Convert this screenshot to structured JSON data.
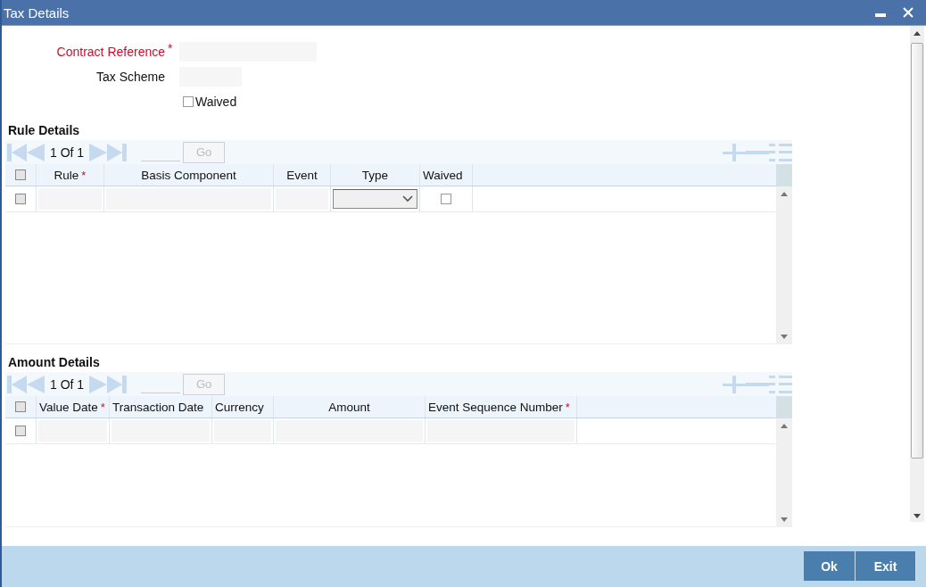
{
  "window": {
    "title": "Tax Details"
  },
  "form": {
    "contract_reference": {
      "label": "Contract Reference",
      "required_mark": "*"
    },
    "tax_scheme": {
      "label": "Tax Scheme"
    },
    "waived": {
      "label": "Waived",
      "checked": false
    }
  },
  "sections": [
    {
      "title": "Rule Details",
      "pager": "1 Of 1",
      "go_button": {
        "label": "Go",
        "disabled": true
      },
      "select_all_checked": false,
      "columns": [
        {
          "label": "Rule",
          "required_mark": "*"
        },
        {
          "label": "Basis Component"
        },
        {
          "label": "Event"
        },
        {
          "label": "Type"
        },
        {
          "label": "Waived"
        }
      ],
      "rows": [
        {
          "checked": false,
          "cells": [
            {
              "kind": "field"
            },
            {
              "kind": "field"
            },
            {
              "kind": "field"
            },
            {
              "kind": "select"
            },
            {
              "kind": "checkbox",
              "checked": false
            }
          ]
        }
      ]
    },
    {
      "title": "Amount Details",
      "pager": "1 Of 1",
      "go_button": {
        "label": "Go",
        "disabled": true
      },
      "select_all_checked": false,
      "columns": [
        {
          "label": "Value Date",
          "required_mark": "*"
        },
        {
          "label": "Transaction Date"
        },
        {
          "label": "Currency"
        },
        {
          "label": "Amount"
        },
        {
          "label": "Event Sequence Number",
          "required_mark": "*"
        }
      ],
      "rows": [
        {
          "checked": false,
          "cells": [
            {
              "kind": "field"
            },
            {
              "kind": "field"
            },
            {
              "kind": "field"
            },
            {
              "kind": "field"
            },
            {
              "kind": "field"
            }
          ]
        }
      ]
    }
  ],
  "buttons": [
    {
      "label": "Ok"
    },
    {
      "label": "Exit"
    }
  ]
}
